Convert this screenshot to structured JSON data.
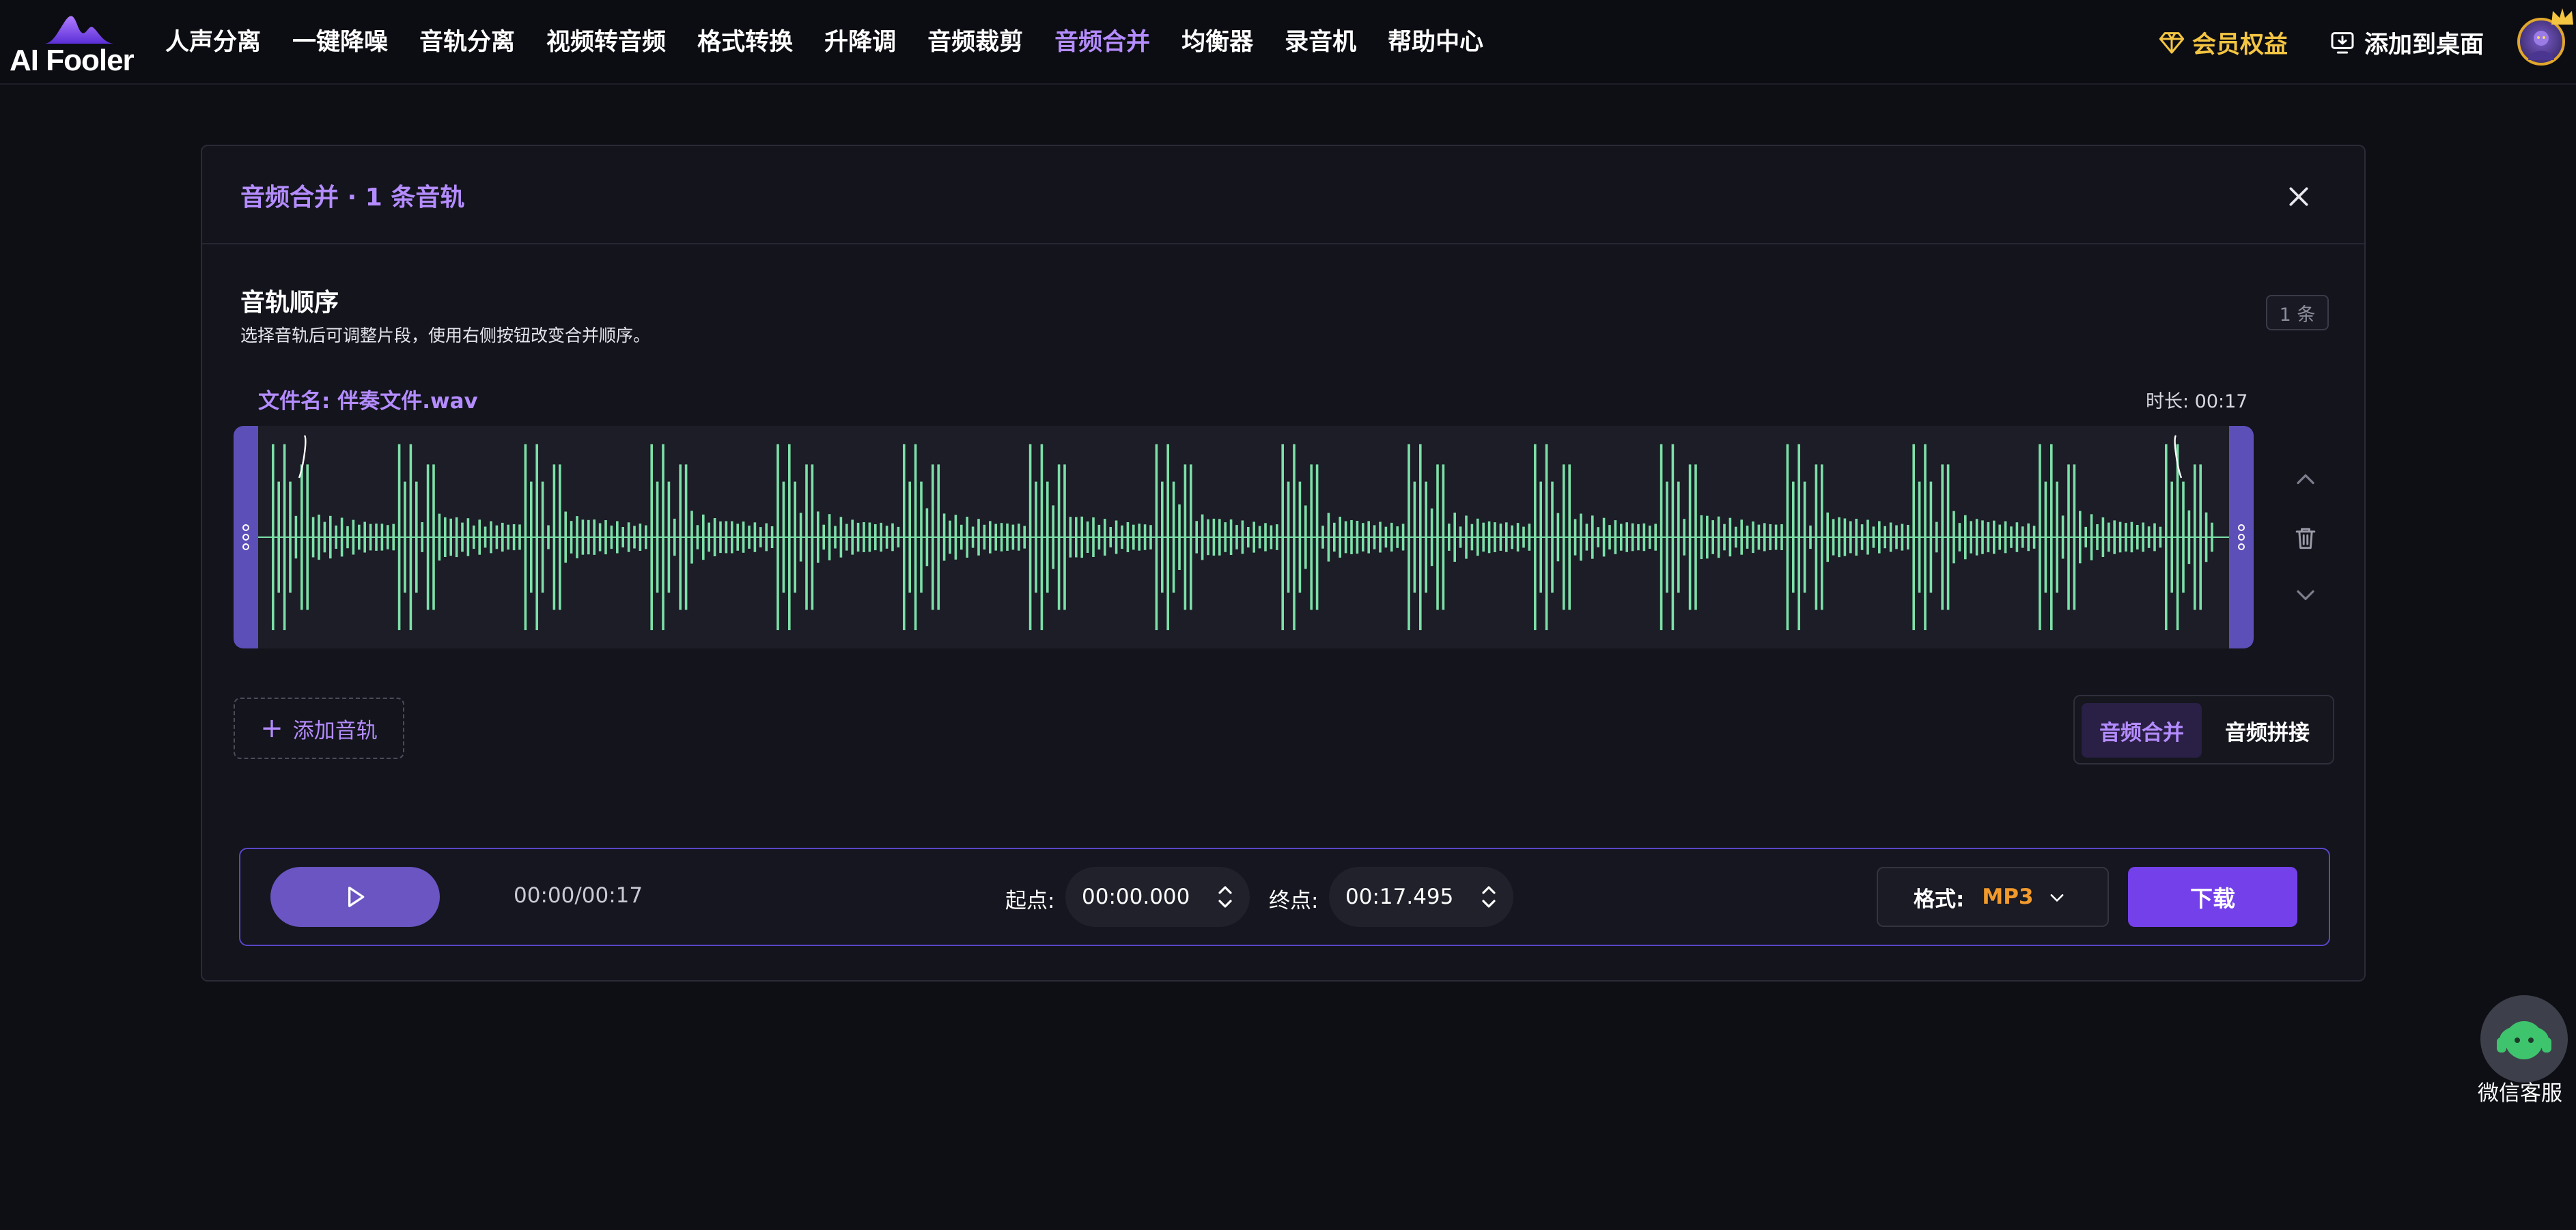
{
  "brand": {
    "name": "AI Fooler"
  },
  "nav": {
    "items": [
      {
        "label": "人声分离",
        "active": false
      },
      {
        "label": "一键降噪",
        "active": false
      },
      {
        "label": "音轨分离",
        "active": false
      },
      {
        "label": "视频转音频",
        "active": false
      },
      {
        "label": "格式转换",
        "active": false
      },
      {
        "label": "升降调",
        "active": false
      },
      {
        "label": "音频裁剪",
        "active": false
      },
      {
        "label": "音频合并",
        "active": true
      },
      {
        "label": "均衡器",
        "active": false
      },
      {
        "label": "录音机",
        "active": false
      },
      {
        "label": "帮助中心",
        "active": false
      }
    ],
    "vip_label": "会员权益",
    "add_desktop_label": "添加到桌面"
  },
  "panel": {
    "title": "音频合并 · 1 条音轨",
    "section_title": "音轨顺序",
    "section_subtitle": "选择音轨后可调整片段，使用右侧按钮改变合并顺序。",
    "track_count_badge": "1 条",
    "track": {
      "file_name": "文件名: 伴奏文件.wav",
      "duration": "时长: 00:17"
    },
    "add_track_label": "添加音轨",
    "modes": [
      "音频合并",
      "音频拼接"
    ],
    "active_mode": "音频合并"
  },
  "player": {
    "time": "00:00/00:17",
    "start_label": "起点:",
    "start_value": "00:00.000",
    "end_label": "终点:",
    "end_value": "00:17.495",
    "format_label": "格式:",
    "format_value": "MP3",
    "download_label": "下载"
  },
  "customer_service": {
    "label": "微信客服"
  },
  "colors": {
    "accent": "#b48cff",
    "primary_button": "#7440ea",
    "wave": "#7ce0a8",
    "format_value": "#f19a2b",
    "vip": "#f4c542"
  }
}
